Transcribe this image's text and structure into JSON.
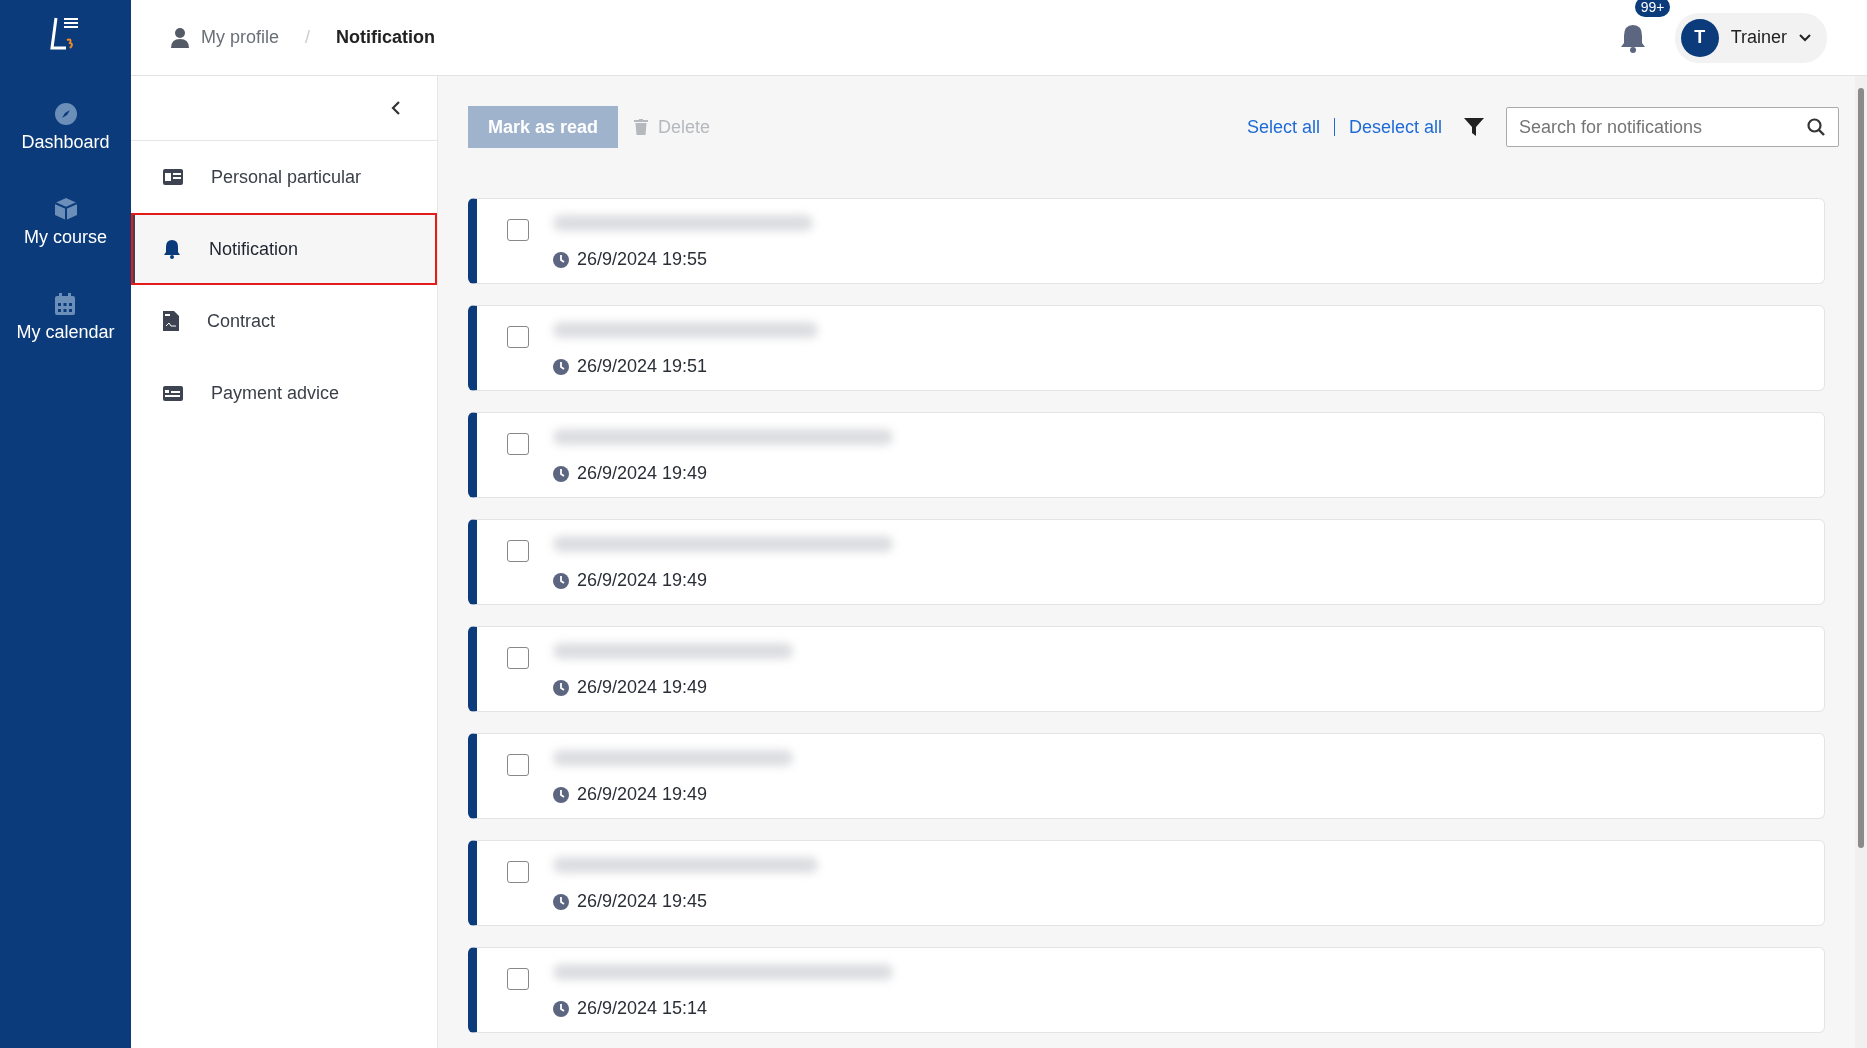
{
  "nav": [
    {
      "label": "Dashboard",
      "kind": "compass",
      "selected": false
    },
    {
      "label": "My course",
      "kind": "box",
      "selected": false
    },
    {
      "label": "My calendar",
      "kind": "calendar",
      "selected": false
    }
  ],
  "breadcrumb": [
    "My profile",
    "/",
    "Notification"
  ],
  "header": {
    "badge": "99+",
    "avatar": "T",
    "user": "Trainer"
  },
  "menu": [
    {
      "label": "Personal particular",
      "kind": "idcard",
      "selected": false
    },
    {
      "label": "Notification",
      "kind": "bell",
      "selected": true
    },
    {
      "label": "Contract",
      "kind": "doc",
      "selected": false
    },
    {
      "label": "Payment advice",
      "kind": "card",
      "selected": false
    }
  ],
  "toolbar": {
    "mark": "Mark as read",
    "delete": "Delete",
    "select_all": "Select all",
    "deselect_all": "Deselect all",
    "search": {
      "placeholder": "Search for notifications"
    }
  },
  "notifications": [
    {
      "time": "26/9/2024 19:55",
      "checked": false
    },
    {
      "time": "26/9/2024 19:51",
      "checked": false
    },
    {
      "time": "26/9/2024 19:49",
      "checked": false
    },
    {
      "time": "26/9/2024 19:49",
      "checked": false
    },
    {
      "time": "26/9/2024 19:49",
      "checked": false
    },
    {
      "time": "26/9/2024 19:49",
      "checked": false
    },
    {
      "time": "26/9/2024 19:45",
      "checked": false
    },
    {
      "time": "26/9/2024 15:14",
      "checked": false
    }
  ]
}
